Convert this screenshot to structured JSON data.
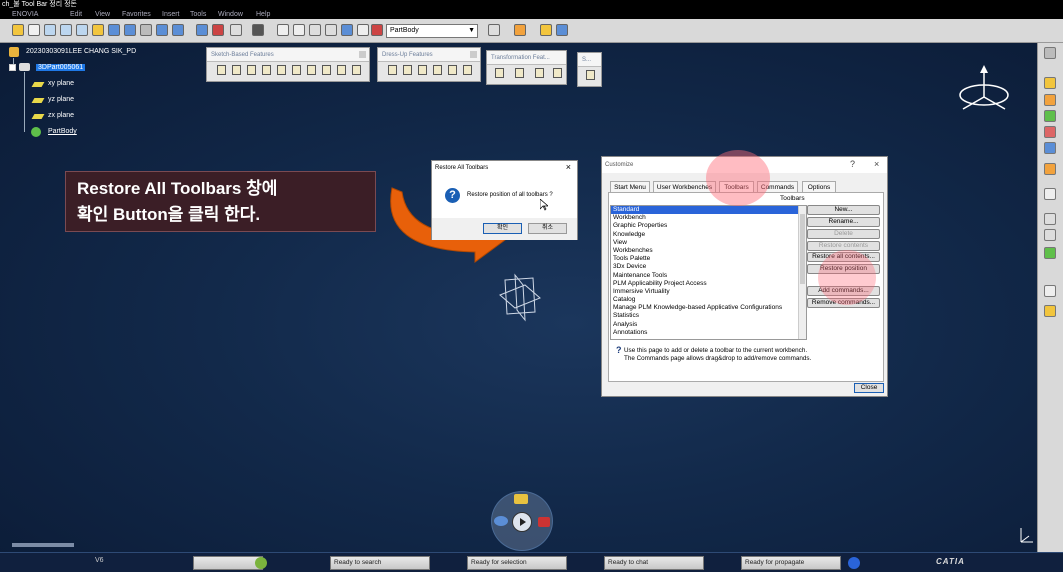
{
  "window": {
    "title": "ch_불 Tool Bar 정리 정돈"
  },
  "menu": {
    "items": [
      "ENOVIA",
      "Edit",
      "View",
      "Favorites",
      "Insert",
      "Tools",
      "Window",
      "Help"
    ]
  },
  "toolbar": {
    "partbody_select": "PartBody"
  },
  "tree": {
    "root": "20230303091LEE CHANG SIK_PD",
    "part": "3DPart005061",
    "planes": [
      "xy plane",
      "yz plane",
      "zx plane"
    ],
    "body": "PartBody"
  },
  "floating_toolbars": {
    "sketch_based": "Sketch-Based Features",
    "dress_up": "Dress-Up Features",
    "transformation": "Transformation Feat...",
    "small": "S..."
  },
  "annotation": {
    "line1": "Restore All Toolbars 창에",
    "line2": "확인 Button을 클릭 한다."
  },
  "restore_dialog": {
    "title": "Restore All Toolbars",
    "close": "×",
    "question_mark": "?",
    "message": "Restore position of all toolbars ?",
    "ok": "확인",
    "cancel": "취소"
  },
  "customize_dialog": {
    "title": "Customize",
    "help": "?",
    "close_x": "×",
    "tabs": [
      "Start Menu",
      "User Workbenches",
      "Toolbars",
      "Commands",
      "Options"
    ],
    "active_tab": "Toolbars",
    "list_label": "Toolbars",
    "toolbars": [
      "Standard",
      "Workbench",
      "Graphic Properties",
      "Knowledge",
      "View",
      "Workbenches",
      "Tools Palette",
      "3Dx Device",
      "Maintenance Tools",
      "PLM Applicability Project Access",
      "Immersive Virtuality",
      "Catalog",
      "Manage PLM Knowledge-based Applicative Configurations",
      "Statistics",
      "Analysis",
      "Annotations"
    ],
    "selected": "Standard",
    "buttons": {
      "new": "New...",
      "rename": "Rename...",
      "delete": "Delete",
      "restore_contents": "Restore contents",
      "restore_all_contents": "Restore all contents...",
      "restore_position": "Restore position",
      "add_commands": "Add commands...",
      "remove_commands": "Remove commands..."
    },
    "info_line1": "Use this page to add or delete a toolbar to the current workbench.",
    "info_line2": "The Commands page allows drag&drop to add/remove commands.",
    "close_button": "Close"
  },
  "status": {
    "version": "V6",
    "search": "Ready to search",
    "selection": "Ready for selection",
    "chat": "Ready to chat",
    "propagate": "Ready for propagate",
    "logo": "CATIA"
  },
  "colors": {
    "background": "#0d1f3c",
    "highlight_circle": "#ff6b78",
    "arrow": "#e8600a",
    "annotation_bg": "#3b1e26"
  }
}
